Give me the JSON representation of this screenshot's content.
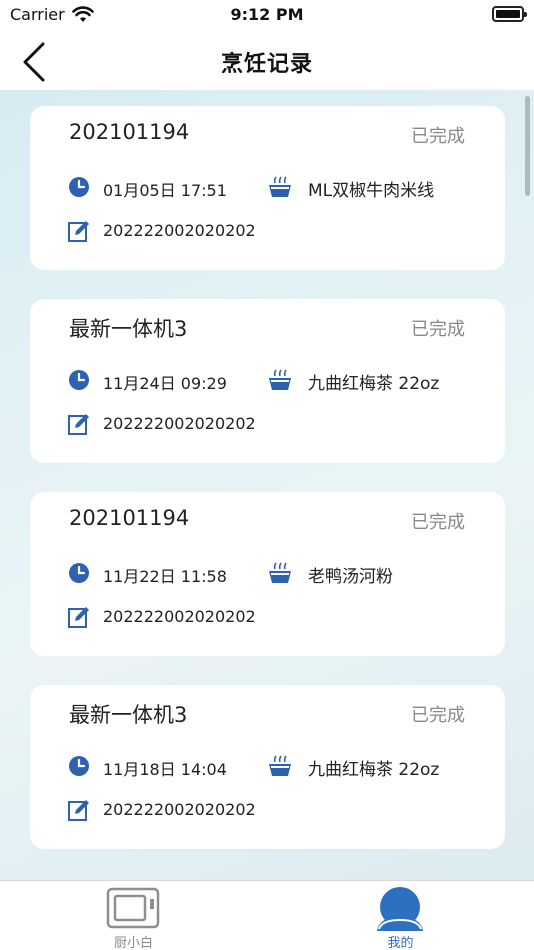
{
  "status_bar": {
    "carrier": "Carrier",
    "time": "9:12 PM"
  },
  "nav": {
    "title": "烹饪记录"
  },
  "records": [
    {
      "title": "202101194",
      "status": "已完成",
      "time": "01月05日 17:51",
      "recipe": "ML双椒牛肉米线",
      "code": "202222002020202"
    },
    {
      "title": "最新一体机3",
      "status": "已完成",
      "time": "11月24日 09:29",
      "recipe": "九曲红梅茶 22oz",
      "code": "202222002020202"
    },
    {
      "title": "202101194",
      "status": "已完成",
      "time": "11月22日 11:58",
      "recipe": "老鸭汤河粉",
      "code": "202222002020202"
    },
    {
      "title": "最新一体机3",
      "status": "已完成",
      "time": "11月18日 14:04",
      "recipe": "九曲红梅茶 22oz",
      "code": "202222002020202"
    }
  ],
  "tabs": [
    {
      "label": "厨小白",
      "icon": "device-icon",
      "active": false
    },
    {
      "label": "我的",
      "icon": "profile-icon",
      "active": true
    }
  ],
  "colors": {
    "accent": "#2d6fc0",
    "icon_blue": "#2e62b0",
    "status_gray": "#888888"
  }
}
